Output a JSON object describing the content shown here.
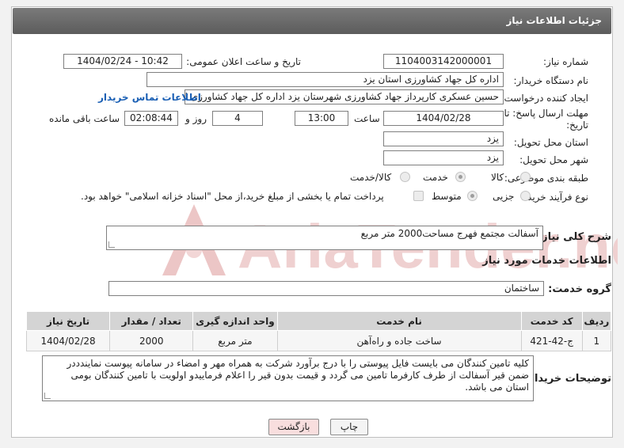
{
  "header": {
    "title": "جزئیات اطلاعات نیاز"
  },
  "fields": {
    "need_number_label": "شماره نیاز:",
    "need_number": "1104003142000001",
    "announce_label": "تاریخ و ساعت اعلان عمومی:",
    "announce_value": "1404/02/24 - 10:42",
    "buyer_org_label": "نام دستگاه خریدار:",
    "buyer_org": "اداره کل جهاد کشاورزی استان یزد",
    "creator_label": "ایجاد کننده درخواست:",
    "creator": "حسین عسکری کارپرداز جهاد کشاورزی شهرستان یزد اداره کل جهاد کشاورزی ا",
    "contact_link": "اطلاعات تماس خریدار",
    "deadline_label_1": "مهلت ارسال پاسخ: تا",
    "deadline_label_2": "تاریخ:",
    "deadline_date": "1404/02/28",
    "time_label": "ساعت",
    "deadline_time": "13:00",
    "days_value": "4",
    "days_label": "روز و",
    "remaining_time": "02:08:44",
    "remaining_label": "ساعت باقی مانده",
    "province_label": "استان محل تحویل:",
    "province": "یزد",
    "city_label": "شهر محل تحویل:",
    "city": "یزد",
    "category_label": "طبقه بندی موضوعی:",
    "category_options": [
      "کالا",
      "خدمت",
      "کالا/خدمت"
    ],
    "process_label": "نوع فرآیند خرید :",
    "process_options": [
      "جزیی",
      "متوسط"
    ],
    "payment_note": "پرداخت تمام یا بخشی از مبلغ خرید،از محل \"اسناد خزانه اسلامی\" خواهد بود."
  },
  "summary": {
    "label": "شرح کلی نیاز:",
    "text": "آسفالت مجتمع فهرج مساحت2000 متر مربع"
  },
  "services": {
    "section_title": "اطلاعات خدمات مورد نیاز",
    "group_label": "گروه خدمت:",
    "group_value": "ساختمان",
    "columns": [
      "ردیف",
      "کد خدمت",
      "نام خدمت",
      "واحد اندازه گیری",
      "تعداد / مقدار",
      "تاریخ نیاز"
    ],
    "rows": [
      [
        "1",
        "ج-42-421",
        "ساخت جاده و راه‌آهن",
        "متر مربع",
        "2000",
        "1404/02/28"
      ]
    ]
  },
  "buyer_notes": {
    "label": "توضیحات خریدار:",
    "text": "کلیه تامین کنندگان می بایست فایل پیوستی را با درج برآورد شرکت به همراه مهر و امضاء در سامانه پیوست نمایندددر ضمن قیر آسفالت از طرف کارفرما تامین می گردد و قیمت بدون قیر را اعلام فرماییدو اولویت با تامین کنندگان بومی استان می باشد."
  },
  "buttons": {
    "print": "چاپ",
    "back": "بازگشت"
  },
  "watermark": {
    "text": "AriaTender.neT"
  },
  "colors": {
    "header": "#6b6b6b",
    "link": "#1a5fb4",
    "back_button": "#f8dede",
    "watermark": "#e8b3b3"
  }
}
